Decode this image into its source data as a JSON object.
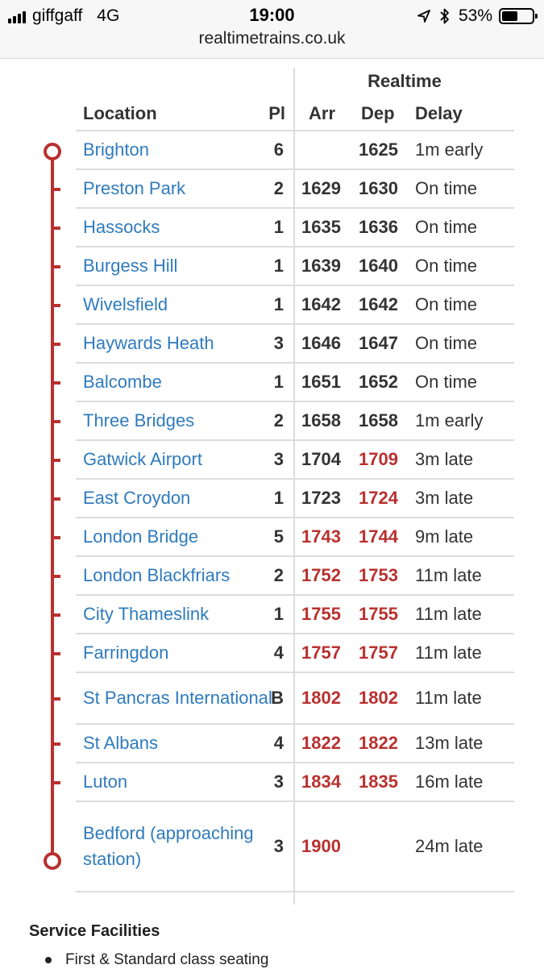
{
  "status_bar": {
    "carrier": "giffgaff",
    "network": "4G",
    "time": "19:00",
    "battery": "53%",
    "battery_level": 0.53
  },
  "browser": {
    "url": "realtimetrains.co.uk"
  },
  "table": {
    "header_group": "Realtime",
    "columns": {
      "location": "Location",
      "platform": "Pl",
      "arr": "Arr",
      "dep": "Dep",
      "delay": "Delay"
    },
    "rows": [
      {
        "location": "Brighton",
        "platform": "6",
        "arr": "",
        "dep": "1625",
        "delay": "1m early",
        "arr_late": false,
        "dep_late": false
      },
      {
        "location": "Preston Park",
        "platform": "2",
        "arr": "1629",
        "dep": "1630",
        "delay": "On time",
        "arr_late": false,
        "dep_late": false
      },
      {
        "location": "Hassocks",
        "platform": "1",
        "arr": "1635",
        "dep": "1636",
        "delay": "On time",
        "arr_late": false,
        "dep_late": false
      },
      {
        "location": "Burgess Hill",
        "platform": "1",
        "arr": "1639",
        "dep": "1640",
        "delay": "On time",
        "arr_late": false,
        "dep_late": false
      },
      {
        "location": "Wivelsfield",
        "platform": "1",
        "arr": "1642",
        "dep": "1642",
        "delay": "On time",
        "arr_late": false,
        "dep_late": false
      },
      {
        "location": "Haywards Heath",
        "platform": "3",
        "arr": "1646",
        "dep": "1647",
        "delay": "On time",
        "arr_late": false,
        "dep_late": false
      },
      {
        "location": "Balcombe",
        "platform": "1",
        "arr": "1651",
        "dep": "1652",
        "delay": "On time",
        "arr_late": false,
        "dep_late": false
      },
      {
        "location": "Three Bridges",
        "platform": "2",
        "arr": "1658",
        "dep": "1658",
        "delay": "1m early",
        "arr_late": false,
        "dep_late": false
      },
      {
        "location": "Gatwick Airport",
        "platform": "3",
        "arr": "1704",
        "dep": "1709",
        "delay": "3m late",
        "arr_late": false,
        "dep_late": true
      },
      {
        "location": "East Croydon",
        "platform": "1",
        "arr": "1723",
        "dep": "1724",
        "delay": "3m late",
        "arr_late": false,
        "dep_late": true
      },
      {
        "location": "London Bridge",
        "platform": "5",
        "arr": "1743",
        "dep": "1744",
        "delay": "9m late",
        "arr_late": true,
        "dep_late": true
      },
      {
        "location": "London Blackfriars",
        "platform": "2",
        "arr": "1752",
        "dep": "1753",
        "delay": "11m late",
        "arr_late": true,
        "dep_late": true
      },
      {
        "location": "City Thameslink",
        "platform": "1",
        "arr": "1755",
        "dep": "1755",
        "delay": "11m late",
        "arr_late": true,
        "dep_late": true
      },
      {
        "location": "Farringdon",
        "platform": "4",
        "arr": "1757",
        "dep": "1757",
        "delay": "11m late",
        "arr_late": true,
        "dep_late": true
      },
      {
        "location": "St Pancras International",
        "platform": "B",
        "arr": "1802",
        "dep": "1802",
        "delay": "11m late",
        "arr_late": true,
        "dep_late": true
      },
      {
        "location": "St Albans",
        "platform": "4",
        "arr": "1822",
        "dep": "1822",
        "delay": "13m late",
        "arr_late": true,
        "dep_late": true
      },
      {
        "location": "Luton",
        "platform": "3",
        "arr": "1834",
        "dep": "1835",
        "delay": "16m late",
        "arr_late": true,
        "dep_late": true
      },
      {
        "location": "Bedford (approaching station)",
        "platform": "3",
        "arr": "1900",
        "dep": "",
        "delay": "24m late",
        "arr_late": true,
        "dep_late": false
      }
    ]
  },
  "facilities": {
    "title": "Service Facilities",
    "items": [
      "First & Standard class seating"
    ]
  },
  "colors": {
    "link": "#2f7bbd",
    "late": "#b8312f",
    "route": "#b8312f",
    "text": "#333333"
  }
}
